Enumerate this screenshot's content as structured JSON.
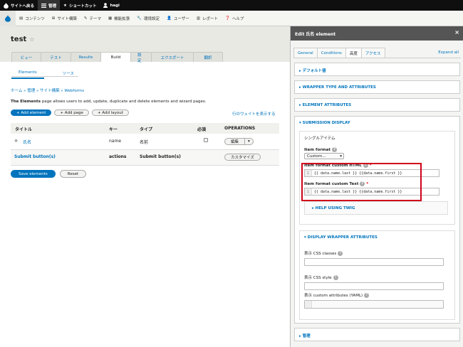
{
  "toolbar": {
    "back_to_site": "サイトへ戻る",
    "manage": "管理",
    "shortcuts": "ショートカット",
    "user": "hagi"
  },
  "admin_menu": {
    "items": [
      "コンテンツ",
      "サイト構築",
      "テーマ",
      "機能拡張",
      "環境設定",
      "ユーザー",
      "レポート",
      "ヘルプ"
    ]
  },
  "page": {
    "title": "test",
    "tabs": [
      "ビュー",
      "テスト",
      "Results",
      "Build",
      "設定",
      "エクスポート",
      "翻訳"
    ],
    "active_tab": "Build",
    "subtabs": [
      "Elements",
      "ソース"
    ],
    "breadcrumb": "ホーム » 管理 » サイト構築 » Webforms",
    "description_bold": "The Elements",
    "description_rest": " page allows users to add, update, duplicate and delete elements and wizard pages.",
    "add_element": "+ Add element",
    "add_page": "+ Add page",
    "add_layout": "+ Add layout",
    "show_weights": "行のウェイトを表示する",
    "table": {
      "headers": [
        "タイトル",
        "キー",
        "タイプ",
        "必須",
        "OPERATIONS"
      ],
      "rows": [
        {
          "title": "氏名",
          "key": "name",
          "type": "名前",
          "op": "編集"
        },
        {
          "title": "Submit button(s)",
          "key": "actions",
          "type": "Submit button(s)",
          "op": "カスタマイズ"
        }
      ]
    },
    "save_elements": "Save elements",
    "reset": "Reset"
  },
  "panel": {
    "title": "Edit 氏名 element",
    "tabs": [
      "General",
      "Conditions",
      "高度",
      "アクセス"
    ],
    "active_tab": "高度",
    "expand_all": "Expand all",
    "sections": {
      "default_value": "▸ デフォルト値",
      "wrapper_type": "▸ WRAPPER TYPE AND ATTRIBUTES",
      "element_attributes": "▸ ELEMENT ATTRIBUTES",
      "submission_display": "▾ SUBMISSION DISPLAY",
      "single_item": "シングルアイテム",
      "item_format_label": "Item format",
      "item_format_value": "Custom…",
      "custom_html_label": "Item format custom HTML",
      "custom_html_value": "{{ data.name.last }} {{data.name.first }}",
      "custom_text_label": "Item format custom Text",
      "custom_text_value": "{{ data.name.last }} {{data.name.first }}",
      "line_no": "1",
      "help_twig": "▸ HELP USING TWIG",
      "display_wrapper": "▾ DISPLAY WRAPPER ATTRIBUTES",
      "css_classes": "表示 CSS classes",
      "css_style": "表示 CSS style",
      "custom_attrs": "表示 custom attributes (YAML)",
      "admin": "▸ 管理"
    }
  },
  "colors": {
    "accent": "#0074bd",
    "toolbar": "#0f0f0f",
    "highlight": "#d0021b"
  }
}
